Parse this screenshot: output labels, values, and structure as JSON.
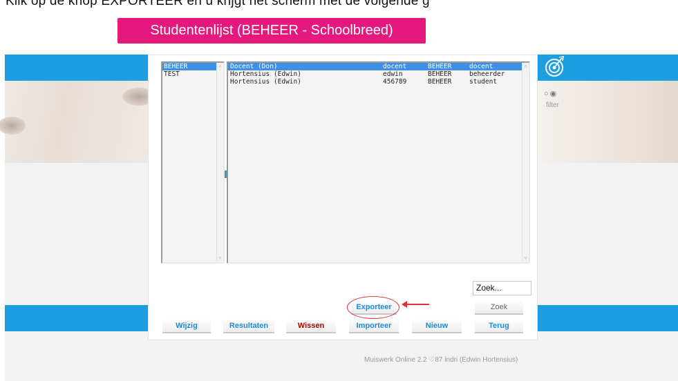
{
  "instruction_text": "Klik op de knop EXPORTEER en u krijgt het scherm met de volgende g",
  "title": "Studentenlijst (BEHEER - Schoolbreed)",
  "groups": [
    "BEHEER",
    "TEST"
  ],
  "students": [
    {
      "name": "Docent (Don)",
      "login": "docent",
      "group": "BEHEER",
      "role": "docent"
    },
    {
      "name": "Hortensius (Edwin)",
      "login": "edwin",
      "group": "BEHEER",
      "role": "beheerder"
    },
    {
      "name": "Hortensius (Edwin)",
      "login": "456789",
      "group": "BEHEER",
      "role": "student"
    }
  ],
  "search": {
    "value": "Zoek..."
  },
  "buttons": {
    "exporteer": "Exporteer",
    "zoek": "Zoek",
    "wijzig": "Wijzig",
    "resultaten": "Resultaten",
    "wissen": "Wissen",
    "importeer": "Importeer",
    "nieuw": "Nieuw",
    "terug": "Terug"
  },
  "radios": "○◉",
  "filter_label": "filter",
  "footer": "Muiswerk Online 2.2  ♡87  indri  (Edwin Hortensius)",
  "colors": {
    "brand_pink": "#e5197d",
    "band_blue": "#1c9ee3",
    "selection": "#3d8fe7",
    "annotation_red": "#e03030"
  },
  "icons": {
    "target": "target-icon",
    "scroll_up": "scroll-up-icon",
    "scroll_down": "scroll-down-icon"
  }
}
